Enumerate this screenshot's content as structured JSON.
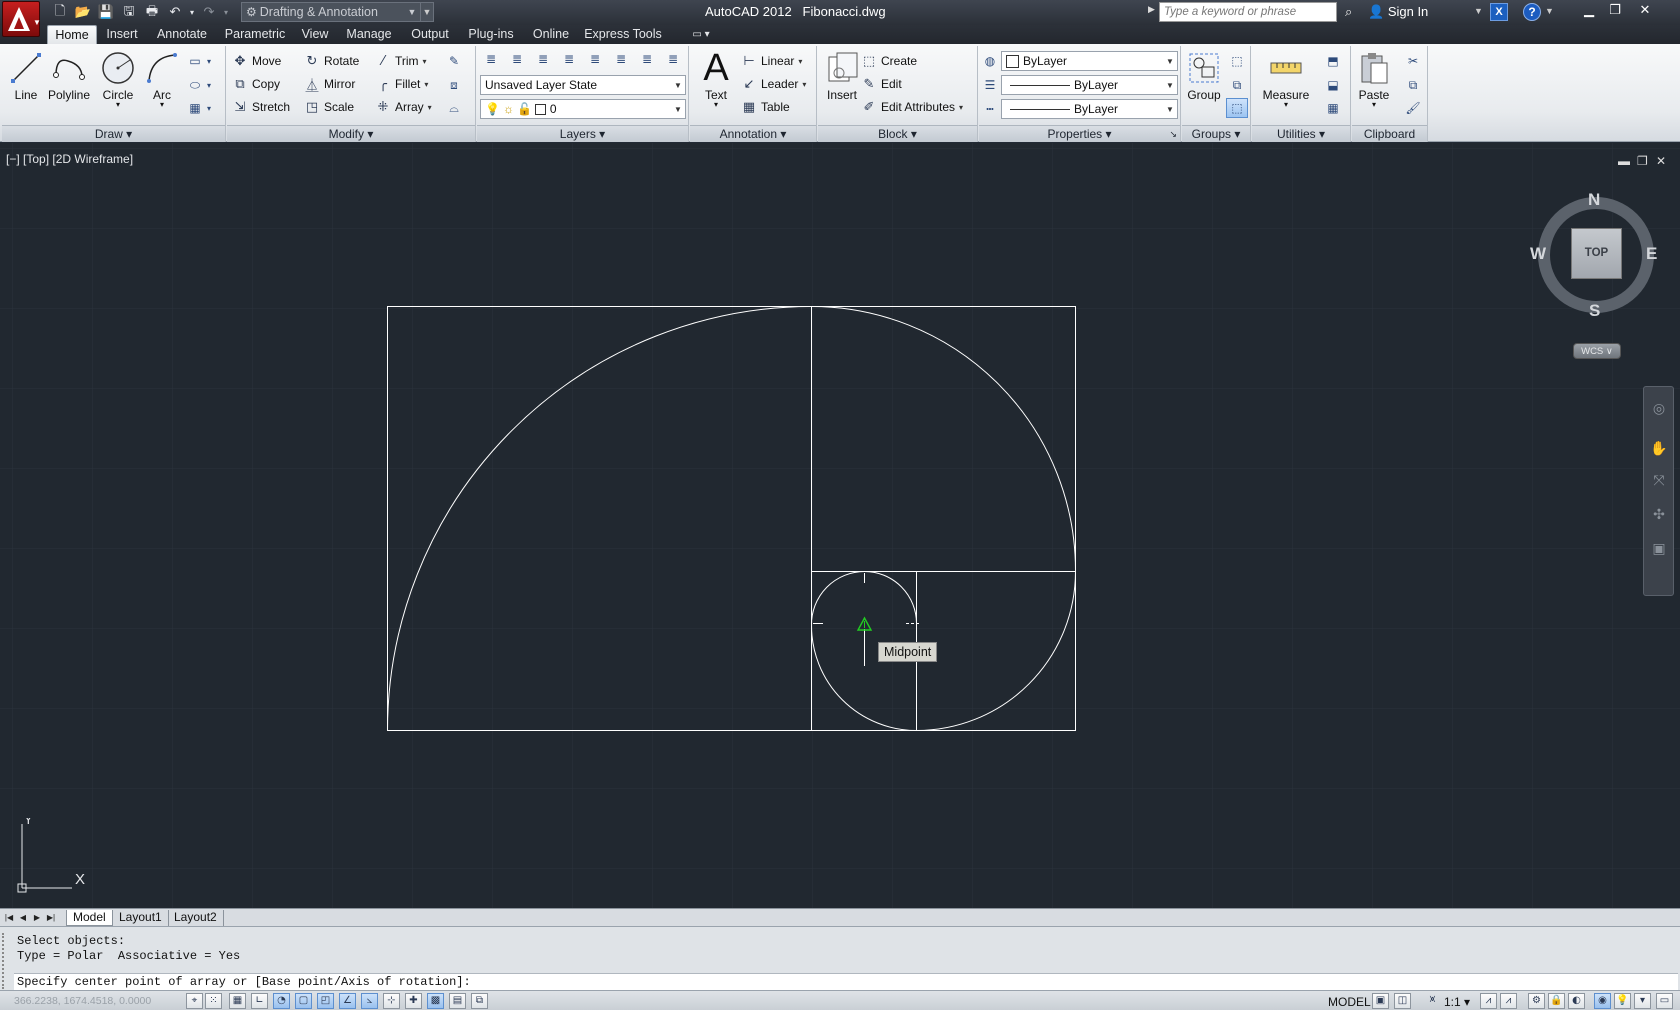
{
  "title_bar": {
    "workspace": "Drafting & Annotation",
    "title": "AutoCAD 2012   Fibonacci.dwg",
    "search_placeholder": "Type a keyword or phrase",
    "sign_in": "Sign In"
  },
  "ribbon_tabs": [
    "Home",
    "Insert",
    "Annotate",
    "Parametric",
    "View",
    "Manage",
    "Output",
    "Plug-ins",
    "Online",
    "Express Tools"
  ],
  "active_tab": "Home",
  "draw": {
    "title": "Draw",
    "line": "Line",
    "polyline": "Polyline",
    "circle": "Circle",
    "arc": "Arc"
  },
  "modify": {
    "title": "Modify",
    "move": "Move",
    "rotate": "Rotate",
    "trim": "Trim",
    "copy": "Copy",
    "mirror": "Mirror",
    "fillet": "Fillet",
    "stretch": "Stretch",
    "scale": "Scale",
    "array": "Array"
  },
  "layers": {
    "title": "Layers",
    "layer_state": "Unsaved Layer State",
    "current_layer": "0"
  },
  "annotation": {
    "title": "Annotation",
    "text": "Text",
    "linear": "Linear",
    "leader": "Leader",
    "table": "Table"
  },
  "block": {
    "title": "Block",
    "insert": "Insert",
    "create": "Create",
    "edit": "Edit",
    "edit_attributes": "Edit Attributes"
  },
  "properties": {
    "title": "Properties",
    "color": "ByLayer",
    "linetype": "ByLayer",
    "lineweight": "ByLayer"
  },
  "groups": {
    "title": "Groups",
    "group": "Group"
  },
  "utilities": {
    "title": "Utilities",
    "measure": "Measure"
  },
  "clipboard": {
    "title": "Clipboard",
    "paste": "Paste"
  },
  "viewport": {
    "label": "[−] [Top] [2D Wireframe]",
    "snap_tooltip": "Midpoint",
    "viewcube": {
      "n": "N",
      "s": "S",
      "e": "E",
      "w": "W",
      "face": "TOP",
      "wcs": "WCS ∨"
    },
    "ucs": {
      "x": "X",
      "y": "Y"
    }
  },
  "layout_tabs": [
    "Model",
    "Layout1",
    "Layout2"
  ],
  "active_layout": "Model",
  "command_history": [
    "Select objects:",
    "Type = Polar  Associative = Yes"
  ],
  "command_prompt": "Specify center point of array or [Base point/Axis of rotation]:",
  "status": {
    "coords": "366.2238, 1674.4518, 0.0000",
    "space": "MODEL",
    "scale": "1:1"
  },
  "colors": {
    "background": "#212830",
    "geometry": "#ffffff",
    "snap_marker": "#22cc22"
  }
}
